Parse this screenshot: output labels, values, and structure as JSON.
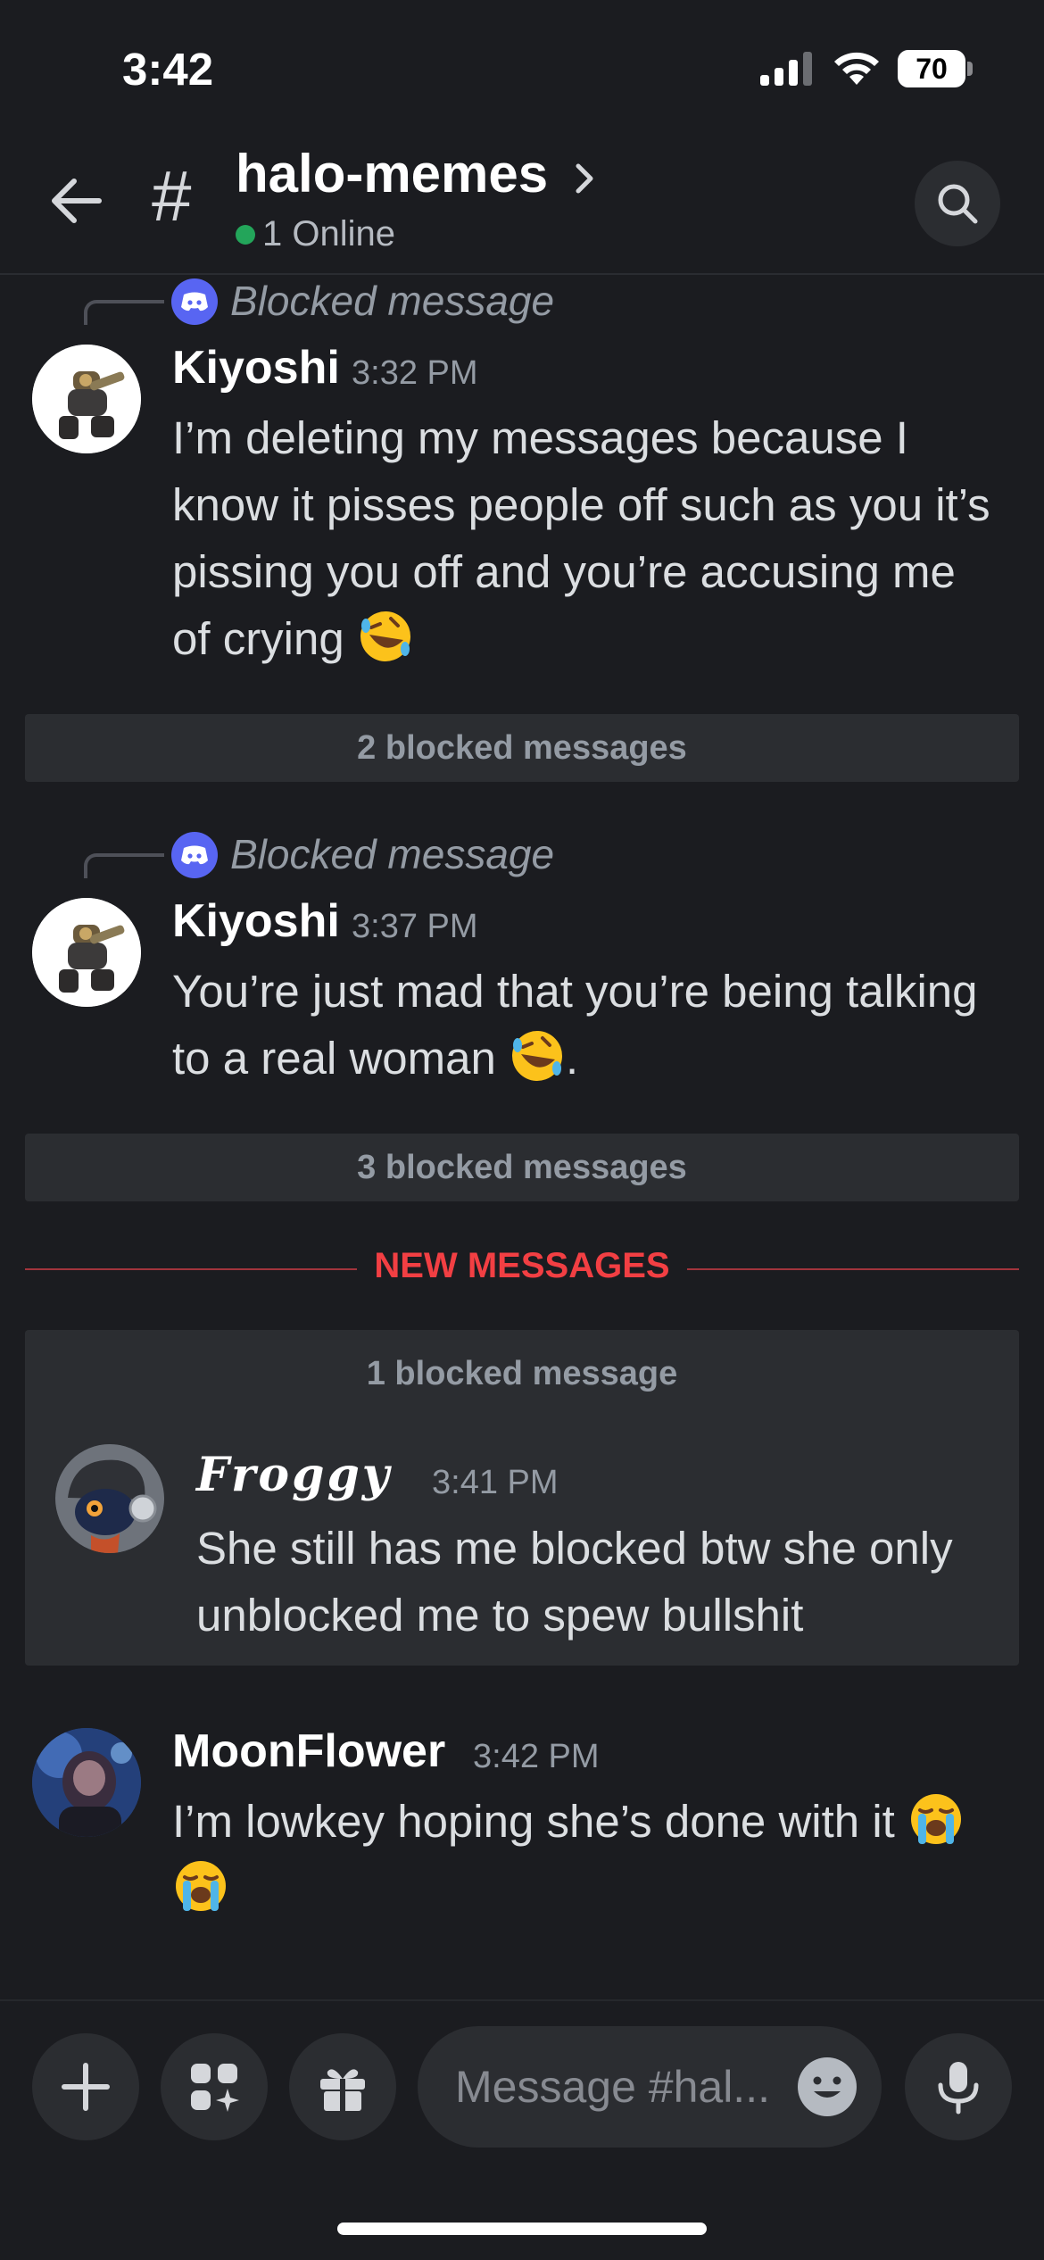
{
  "status_bar": {
    "time": "3:42",
    "battery": "70"
  },
  "header": {
    "channel_name": "halo-memes",
    "online_text": "1 Online"
  },
  "messages": [
    {
      "reply_text": "Blocked message",
      "author": "Kiyoshi",
      "time": "3:32 PM",
      "text": "I’m deleting my messages because I know it pisses people off such as you it’s pissing you off and you’re accusing me of crying",
      "emoji": "rolling-on-floor-laughing"
    },
    {
      "reply_text": "Blocked message",
      "author": "Kiyoshi",
      "time": "3:37 PM",
      "text": "You’re just mad that you’re being talking to a real woman",
      "emoji": "rolling-on-floor-laughing",
      "text_after": "."
    },
    {
      "author": "Froggy",
      "time": "3:41 PM",
      "text": "She still has me blocked btw she only unblocked me to spew bullshit"
    },
    {
      "author": "MoonFlower",
      "time": "3:42 PM",
      "text": "I’m lowkey hoping she’s done with it",
      "emoji": "loudly-crying"
    }
  ],
  "blocked_bars": [
    "2 blocked messages",
    "3 blocked messages",
    "1 blocked message"
  ],
  "new_messages_label": "NEW MESSAGES",
  "composer": {
    "placeholder": "Message #hal..."
  },
  "colors": {
    "background": "#1b1c20",
    "accent": "#5865f2",
    "new_messages": "#f23f43",
    "online": "#23a55a"
  }
}
